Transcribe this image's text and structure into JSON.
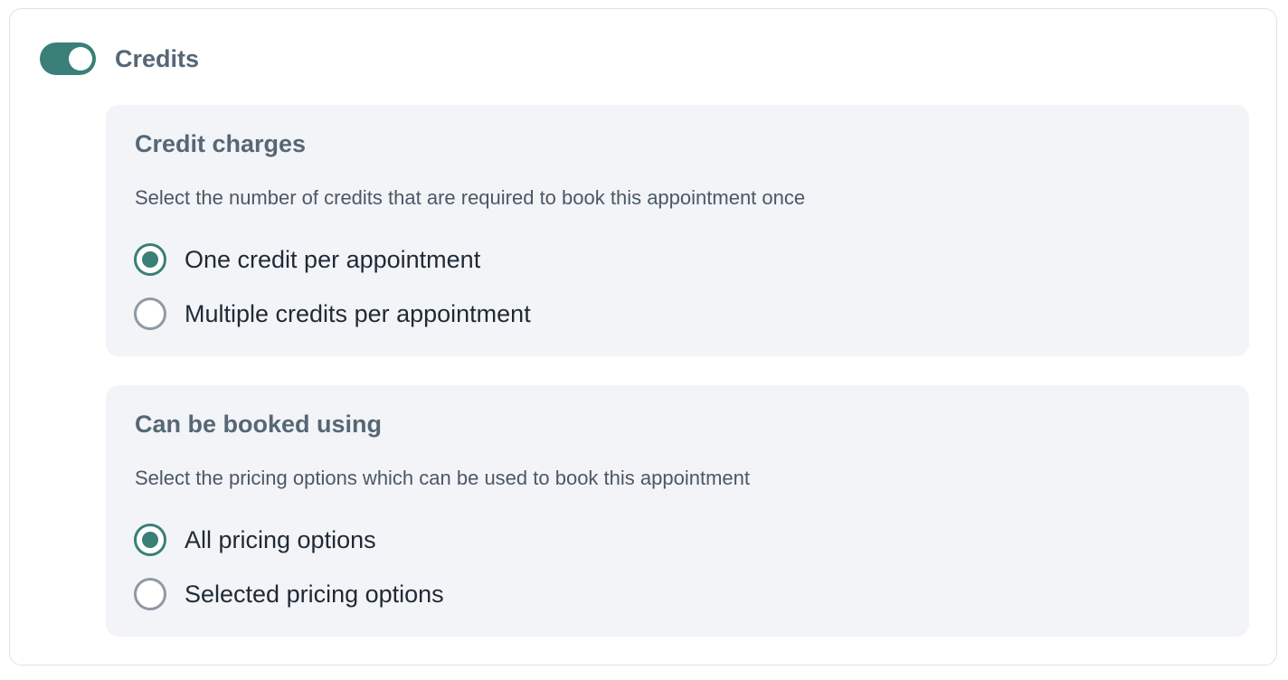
{
  "colors": {
    "accent": "#3a7f78",
    "panel_bg": "#f3f4f8",
    "heading_text": "#566775",
    "body_text": "#1f2a35"
  },
  "credits": {
    "label": "Credits",
    "toggle_on": true
  },
  "credit_charges": {
    "title": "Credit charges",
    "description": "Select the number of credits that are required to book this appointment once",
    "options": [
      {
        "label": "One credit per appointment",
        "selected": true
      },
      {
        "label": "Multiple credits per appointment",
        "selected": false
      }
    ]
  },
  "booked_using": {
    "title": "Can be booked using",
    "description": "Select the pricing options which can be used to book this appointment",
    "options": [
      {
        "label": "All pricing options",
        "selected": true
      },
      {
        "label": "Selected pricing options",
        "selected": false
      }
    ]
  }
}
